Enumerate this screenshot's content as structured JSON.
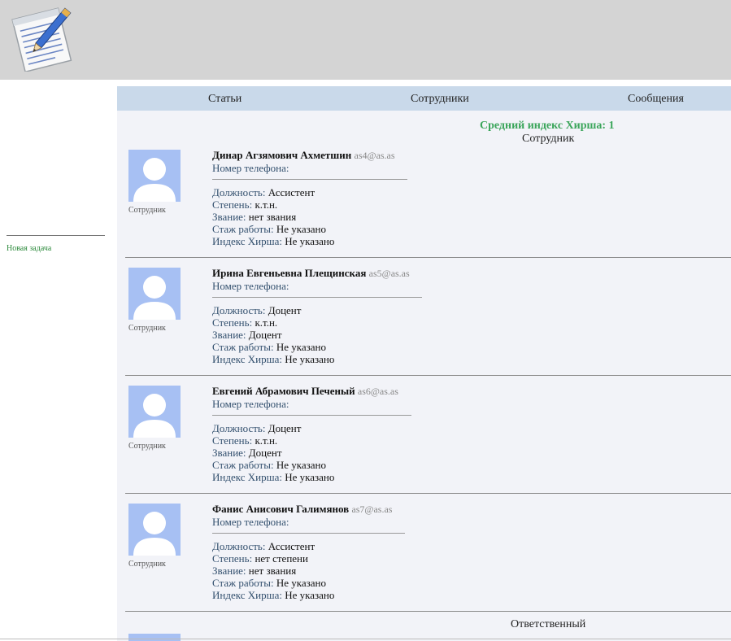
{
  "sidebar": {
    "new_task": "Новая задача"
  },
  "nav": {
    "articles": "Статьи",
    "staff": "Сотрудники",
    "messages": "Сообщения"
  },
  "summary": {
    "hirsch_average": "Средний индекс Хирша: 1",
    "section_employee": "Сотрудник",
    "section_responsible": "Ответственный"
  },
  "labels": {
    "phone": "Номер телефона:",
    "position": "Должность:",
    "degree": "Степень:",
    "rank": "Звание:",
    "experience": "Стаж работы:",
    "hirsch": "Индекс Хирша:",
    "avatar_caption": "Сотрудник"
  },
  "employees": [
    {
      "name": "Динар Агзямович Ахметшин",
      "email": "as4@as.as",
      "phone": "",
      "position": "Ассистент",
      "degree": "к.т.н.",
      "rank": "нет звания",
      "experience": "Не указано",
      "hirsch": "Не указано"
    },
    {
      "name": "Ирина Евгеньевна Плещинская",
      "email": "as5@as.as",
      "phone": "",
      "position": "Доцент",
      "degree": "к.т.н.",
      "rank": "Доцент",
      "experience": "Не указано",
      "hirsch": "Не указано"
    },
    {
      "name": "Евгений Абрамович Печеный",
      "email": "as6@as.as",
      "phone": "",
      "position": "Доцент",
      "degree": "к.т.н.",
      "rank": "Доцент",
      "experience": "Не указано",
      "hirsch": "Не указано"
    },
    {
      "name": "Фанис Анисович Галимянов",
      "email": "as7@as.as",
      "phone": "",
      "position": "Ассистент",
      "degree": "нет степени",
      "rank": "нет звания",
      "experience": "Не указано",
      "hirsch": "Не указано"
    }
  ],
  "icons": {
    "logo": "notepad-pen-icon",
    "avatar": "user-placeholder-icon"
  },
  "colors": {
    "header_bg": "#d4d4d4",
    "nav_bg": "#c9d9ea",
    "main_bg": "#f2f3f8",
    "accent_green": "#3aa55a",
    "avatar_bg": "#a7c0f3"
  }
}
